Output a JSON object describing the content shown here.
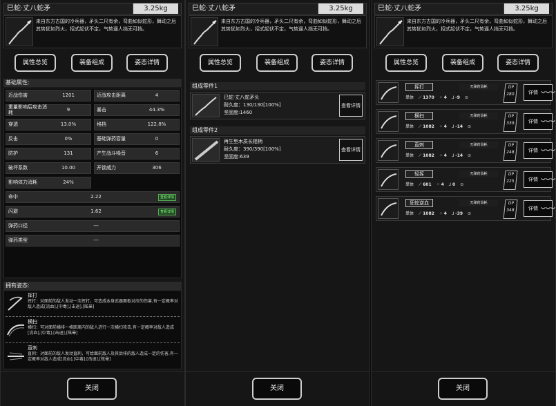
{
  "item": {
    "name": "巳蛇·丈八蛇矛",
    "weight": "3.25kg",
    "desc": "来自东方古国的冷兵器，矛头二尺有余，弯曲如似蛇形，舞动之后其势犹如烈火，招式起伏不定，气势逼人挡无可挡。"
  },
  "tabs": [
    "属性总览",
    "装备组成",
    "姿态详情"
  ],
  "close_label": "关闭",
  "attrs_title": "基础属性:",
  "attrs": [
    [
      "近战伤害",
      "1201",
      "近战攻击距离",
      "4"
    ],
    [
      "重量影响后攻击消耗",
      "9",
      "暴击",
      "44.3%"
    ],
    [
      "穿透",
      "13.0%",
      "格挡",
      "122.8%"
    ],
    [
      "反击",
      "0%",
      "基础弹药容量",
      "0"
    ],
    [
      "防护",
      "131",
      "产生战斗噪音",
      "6"
    ],
    [
      "破坏系数",
      "10.00",
      "开锁威力",
      "306"
    ],
    [
      "影响体力消耗",
      "24%"
    ]
  ],
  "wide_attrs": [
    [
      "命中",
      "2.22",
      "查看详情"
    ],
    [
      "闪避",
      "1.62",
      "查看详情"
    ],
    [
      "弹药口径",
      "---",
      ""
    ],
    [
      "弹药类型",
      "---",
      ""
    ]
  ],
  "poses_title": "拥有姿态:",
  "poses": [
    {
      "name": "挥打",
      "text": "挥打：对面前的敌人发动一次挥打，可造成本身武器面板对应的伤害,有一定概率对敌人造成[流血],[中毒],[击退],[眩晕]"
    },
    {
      "name": "横扫",
      "text": "横扫：可对面前横排一格距离内的敌人进行一次横扫攻击,有一定概率对敌人造成[流血],[中毒],[击退],[眩晕]"
    },
    {
      "name": "直刺",
      "text": "直刺：对面前的敌人发动直刺，可给面前敌人及其后排的敌人造成一定的伤害,有一定概率对敌人造成[流血],[中毒],[击退],[眩晕]"
    }
  ],
  "components": [
    {
      "title": "组成零件1",
      "name": "巳蛇·丈八蛇矛头",
      "durability": "耐久度：130/130[100%]",
      "hardness": "坚固度:1460",
      "btn": "查看详情"
    },
    {
      "title": "组成零件2",
      "name": "再生型木质长棍柄",
      "durability": "耐久度：390/390[100%]",
      "hardness": "坚固度:639",
      "btn": "查看详情"
    }
  ],
  "moves": [
    {
      "name": "挥打",
      "note": "无弹药消耗",
      "target": "单体",
      "dmg": "1370",
      "a": "4",
      "b": "-9",
      "dp": "280",
      "detail": "详情"
    },
    {
      "name": "横扫",
      "note": "无弹药消耗",
      "target": "单体",
      "dmg": "1082",
      "a": "4",
      "b": "-14",
      "dp": "339",
      "detail": "详情"
    },
    {
      "name": "直刺",
      "note": "无弹药消耗",
      "target": "单体",
      "dmg": "1082",
      "a": "4",
      "b": "-14",
      "dp": "248",
      "detail": "详情"
    },
    {
      "name": "轻挥",
      "note": "无弹药消耗",
      "target": "单体",
      "dmg": "601",
      "a": "4",
      "b": "0",
      "dp": "225",
      "detail": "详情"
    },
    {
      "name": "狂蛇逆血",
      "note": "无弹药消耗",
      "target": "单体",
      "dmg": "1082",
      "a": "4",
      "b": "-39",
      "dp": "348",
      "detail": "详情"
    }
  ]
}
